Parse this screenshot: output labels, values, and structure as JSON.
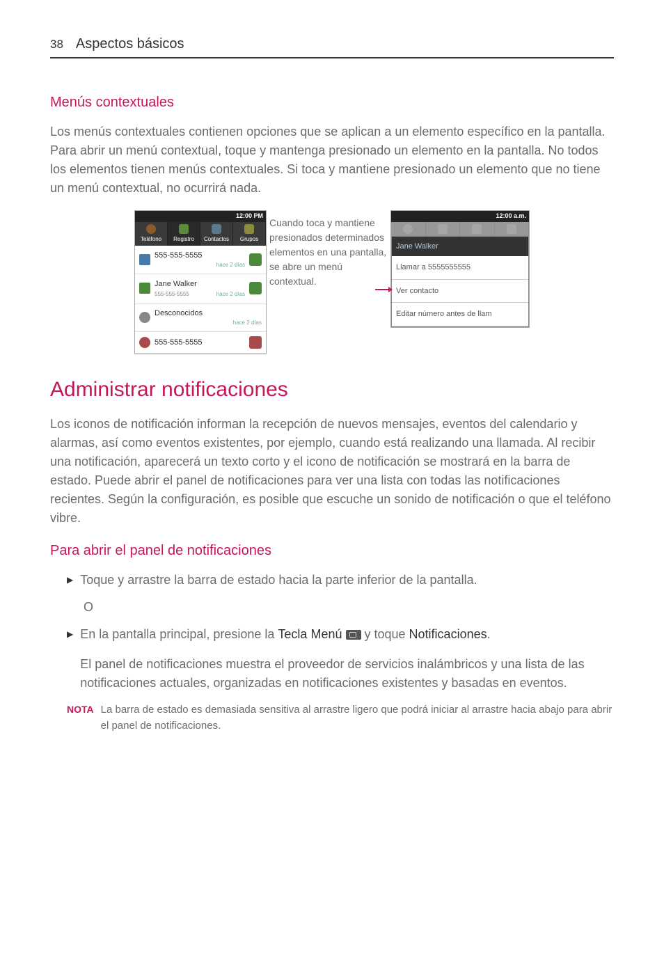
{
  "header": {
    "page_number": "38",
    "title": "Aspectos básicos"
  },
  "section1": {
    "heading": "Menús contextuales",
    "paragraph": "Los menús contextuales contienen opciones que se aplican a un elemento específico en la pantalla. Para abrir un menú contextual, toque y mantenga presionado un elemento en la pantalla. No todos los elementos tienen menús contextuales. Si toca y mantiene presionado un elemento que no tiene un menú contextual, no ocurrirá nada."
  },
  "figure": {
    "left_screenshot": {
      "status_time": "12:00 PM",
      "tabs": [
        "Teléfono",
        "Registro",
        "Contactos",
        "Grupos"
      ],
      "rows": [
        {
          "title": "555-555-5555",
          "sub": "",
          "time": "hace 2 días"
        },
        {
          "title": "Jane Walker",
          "sub": "555-555-5555",
          "time": "hace 2 días"
        },
        {
          "title": "Desconocidos",
          "sub": "",
          "time": "hace 2 días"
        },
        {
          "title": "555-555-5555",
          "sub": "",
          "time": ""
        }
      ]
    },
    "callout": "Cuando toca y mantiene presionados determinados elementos en una pantalla, se abre un menú contextual.",
    "right_screenshot": {
      "status_time": "12:00 a.m.",
      "menu_header": "Jane Walker",
      "menu_items": [
        "Llamar a 5555555555",
        "Ver contacto",
        "Editar número antes de llam"
      ]
    }
  },
  "section2": {
    "heading": "Administrar notificaciones",
    "paragraph": "Los iconos de notificación informan la recepción de nuevos mensajes, eventos del calendario y alarmas, así como eventos existentes, por ejemplo, cuando está realizando una llamada. Al recibir una notificación, aparecerá un texto corto y el icono de notificación se mostrará en la barra de estado. Puede abrir el panel de notificaciones para ver una lista con todas las notificaciones recientes. Según la configuración, es posible que escuche un sonido de notificación o que el teléfono vibre."
  },
  "section3": {
    "heading": "Para abrir el panel de notificaciones",
    "bullet1": "Toque y arrastre la barra de estado hacia la parte inferior de la pantalla.",
    "or": "O",
    "bullet2_pre": "En la pantalla principal, presione la ",
    "bullet2_key": "Tecla Menú",
    "bullet2_post": " y toque ",
    "bullet2_end": "Notificaciones",
    "bullet2_period": ".",
    "sub_paragraph": "El panel de notificaciones muestra el proveedor de servicios inalámbricos y una lista de las notificaciones actuales, organizadas en notificaciones existentes y basadas en eventos."
  },
  "note": {
    "label": "NOTA",
    "text": "La barra de estado es demasiada sensitiva al arrastre ligero que podrá iniciar al arrastre hacia abajo para abrir el panel de notificaciones."
  }
}
